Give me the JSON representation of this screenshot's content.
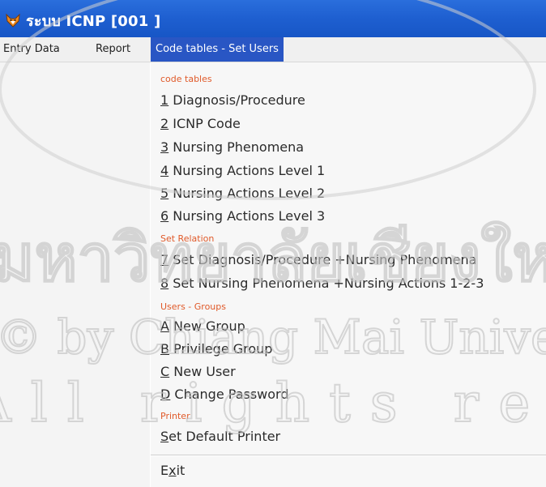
{
  "window": {
    "title": "ระบบ ICNP  [001          ]",
    "icon": "fox-icon",
    "accent": "#1e5fd0"
  },
  "menubar": {
    "items": [
      {
        "label": "Entry Data"
      },
      {
        "label": "Report"
      },
      {
        "label": "Code tables - Set Users"
      }
    ],
    "active_color": "#2956c4"
  },
  "dropdown": {
    "heading_color": "#e05a2a",
    "sections": [
      {
        "heading": "code tables",
        "items": [
          {
            "accel": "1",
            "label": " Diagnosis/Procedure"
          },
          {
            "accel": "2",
            "label": " ICNP Code"
          },
          {
            "accel": "3",
            "label": " Nursing Phenomena"
          },
          {
            "accel": "4",
            "label": " Nursing Actions  Level  1"
          },
          {
            "accel": "5",
            "label": " Nursing Actions  Level  2"
          },
          {
            "accel": "6",
            "label": " Nursing Actions  Level  3"
          }
        ]
      },
      {
        "heading": "Set Relation",
        "items": [
          {
            "accel": "7",
            "label": " Set  Diagnosis/Procedure  +Nursing Phenomena"
          },
          {
            "accel": "8",
            "label": " Set  Nursing Phenomena +Nursing Actions 1-2-3"
          }
        ]
      },
      {
        "heading": "Users - Groups",
        "items": [
          {
            "accel": "A",
            "label": " New Group"
          },
          {
            "accel": "B",
            "label": " Privilege Group"
          },
          {
            "accel": "C",
            "label": " New User"
          },
          {
            "accel": "D",
            "label": " Change Password"
          }
        ]
      },
      {
        "heading": "Printer",
        "items": [
          {
            "accel": "S",
            "label": "et Default Printer"
          }
        ]
      }
    ],
    "exit": {
      "prefix": "E",
      "accel": "x",
      "suffix": "it"
    }
  },
  "watermark": {
    "lines": [
      "มหาวิทยาลัยเชียงใหม่",
      "© by Chiang Mai University",
      "All rights reserved"
    ],
    "color": "#c8c8c8"
  }
}
